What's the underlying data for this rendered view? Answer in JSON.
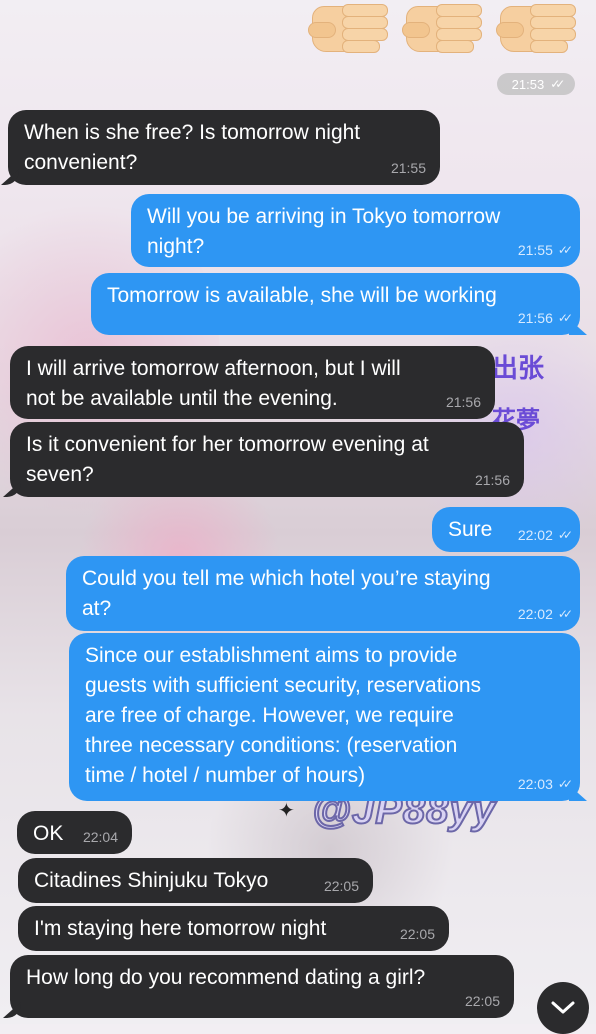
{
  "header_chip": {
    "time": "21:53",
    "ticks": "✓✓"
  },
  "watermark": {
    "line1": "出张",
    "line2": "花夢",
    "handle": "@JP88yy"
  },
  "messages": [
    {
      "dir": "in",
      "lines": [
        "When is she free? Is tomorrow night",
        "convenient?"
      ],
      "time": "21:55"
    },
    {
      "dir": "out",
      "lines": [
        "Will you be arriving in Tokyo tomorrow",
        "night?"
      ],
      "time": "21:55",
      "ticks": "✓✓"
    },
    {
      "dir": "out",
      "lines": [
        "Tomorrow is available, she will be working"
      ],
      "time": "21:56",
      "ticks": "✓✓"
    },
    {
      "dir": "in",
      "lines": [
        "I will arrive tomorrow afternoon, but I will",
        "not be available until the evening."
      ],
      "time": "21:56"
    },
    {
      "dir": "in",
      "lines": [
        "Is it convenient for her tomorrow evening at",
        "seven?"
      ],
      "time": "21:56"
    },
    {
      "dir": "out",
      "lines": [
        "Sure"
      ],
      "time": "22:02",
      "ticks": "✓✓"
    },
    {
      "dir": "out",
      "lines": [
        "Could you tell me which hotel you’re staying",
        "at?"
      ],
      "time": "22:02",
      "ticks": "✓✓"
    },
    {
      "dir": "out",
      "lines": [
        "Since our establishment aims to provide",
        "guests with sufficient security, reservations",
        "are free of charge. However, we require",
        "three necessary conditions: (reservation",
        "time / hotel / number of hours)"
      ],
      "time": "22:03",
      "ticks": "✓✓"
    },
    {
      "dir": "in",
      "lines": [
        "OK"
      ],
      "time": "22:04"
    },
    {
      "dir": "in",
      "lines": [
        "Citadines Shinjuku Tokyo"
      ],
      "time": "22:05"
    },
    {
      "dir": "in",
      "lines": [
        "I'm staying here tomorrow night"
      ],
      "time": "22:05"
    },
    {
      "dir": "in",
      "lines": [
        "How long do you recommend dating a girl?"
      ],
      "time": "22:05"
    }
  ],
  "icons": {
    "scroll_down": "chevron-down-icon",
    "reaction": "fist-emoji-icon"
  },
  "colors": {
    "incoming": "#2b2b2d",
    "outgoing": "#2e96f3"
  }
}
